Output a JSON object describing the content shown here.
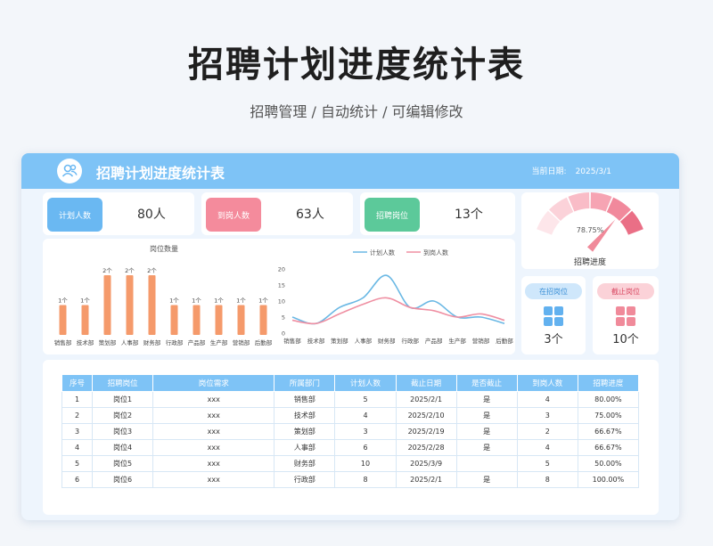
{
  "page": {
    "title": "招聘计划进度统计表",
    "subtitle": "招聘管理 / 自动统计 /  可编辑修改"
  },
  "header": {
    "title": "招聘计划进度统计表",
    "date_label": "当前日期:",
    "date_value": "2025/3/1"
  },
  "stats": [
    {
      "label": "计划人数",
      "value": "80人",
      "color": "#6ab8f2"
    },
    {
      "label": "到岗人数",
      "value": "63人",
      "color": "#f27d90"
    },
    {
      "label": "招聘岗位",
      "value": "13个",
      "color": "#5cc99a"
    }
  ],
  "gauge": {
    "label": "招聘进度",
    "percent_text": "78.75%",
    "value": 0.7875
  },
  "mini_cards": [
    {
      "label": "在招岗位",
      "value": "3个",
      "tag_bg": "#cfe7fb",
      "tag_color": "#3a8fd6",
      "icon_color": "#62b1ef",
      "icon": "grid-icon"
    },
    {
      "label": "截止岗位",
      "value": "10个",
      "tag_bg": "#fbd2d8",
      "tag_color": "#d94a63",
      "icon_color": "#f08a9a",
      "icon": "grid-icon"
    }
  ],
  "chart_data": [
    {
      "type": "bar",
      "title": "岗位数量",
      "categories": [
        "销售部",
        "技术部",
        "策划部",
        "人事部",
        "财务部",
        "行政部",
        "产品部",
        "生产部",
        "营销部",
        "后勤部"
      ],
      "values": [
        1,
        1,
        2,
        2,
        2,
        1,
        1,
        1,
        1,
        1
      ],
      "value_labels": [
        "1个",
        "1个",
        "2个",
        "2个",
        "2个",
        "1个",
        "1个",
        "1个",
        "1个",
        "1个"
      ],
      "ylim": [
        0,
        2
      ],
      "grid": false,
      "color": "#f59a6b"
    },
    {
      "type": "line",
      "categories": [
        "销售部",
        "技术部",
        "策划部",
        "人事部",
        "财务部",
        "行政部",
        "产品部",
        "生产部",
        "营销部",
        "后勤部"
      ],
      "series": [
        {
          "name": "计划人数",
          "values": [
            5,
            3,
            8,
            11,
            18,
            8,
            10,
            5,
            5,
            3
          ],
          "color": "#6ab8e4"
        },
        {
          "name": "到岗人数",
          "values": [
            4,
            3,
            6,
            9,
            11,
            8,
            7,
            5,
            6,
            4
          ],
          "color": "#ef8fa2"
        }
      ],
      "yticks": [
        0,
        5,
        10,
        15,
        20
      ],
      "ylim": [
        0,
        20
      ],
      "legend": "top",
      "grid": false
    }
  ],
  "table": {
    "headers": [
      "序号",
      "招聘岗位",
      "岗位需求",
      "所属部门",
      "计划人数",
      "截止日期",
      "是否截止",
      "到岗人数",
      "招聘进度"
    ],
    "rows": [
      [
        "1",
        "岗位1",
        "xxx",
        "销售部",
        "5",
        "2025/2/1",
        "是",
        "4",
        "80.00%"
      ],
      [
        "2",
        "岗位2",
        "xxx",
        "技术部",
        "4",
        "2025/2/10",
        "是",
        "3",
        "75.00%"
      ],
      [
        "3",
        "岗位3",
        "xxx",
        "策划部",
        "3",
        "2025/2/19",
        "是",
        "2",
        "66.67%"
      ],
      [
        "4",
        "岗位4",
        "xxx",
        "人事部",
        "6",
        "2025/2/28",
        "是",
        "4",
        "66.67%"
      ],
      [
        "5",
        "岗位5",
        "xxx",
        "财务部",
        "10",
        "2025/3/9",
        "",
        "5",
        "50.00%"
      ],
      [
        "6",
        "岗位6",
        "xxx",
        "行政部",
        "8",
        "2025/2/1",
        "是",
        "8",
        "100.00%"
      ]
    ]
  }
}
